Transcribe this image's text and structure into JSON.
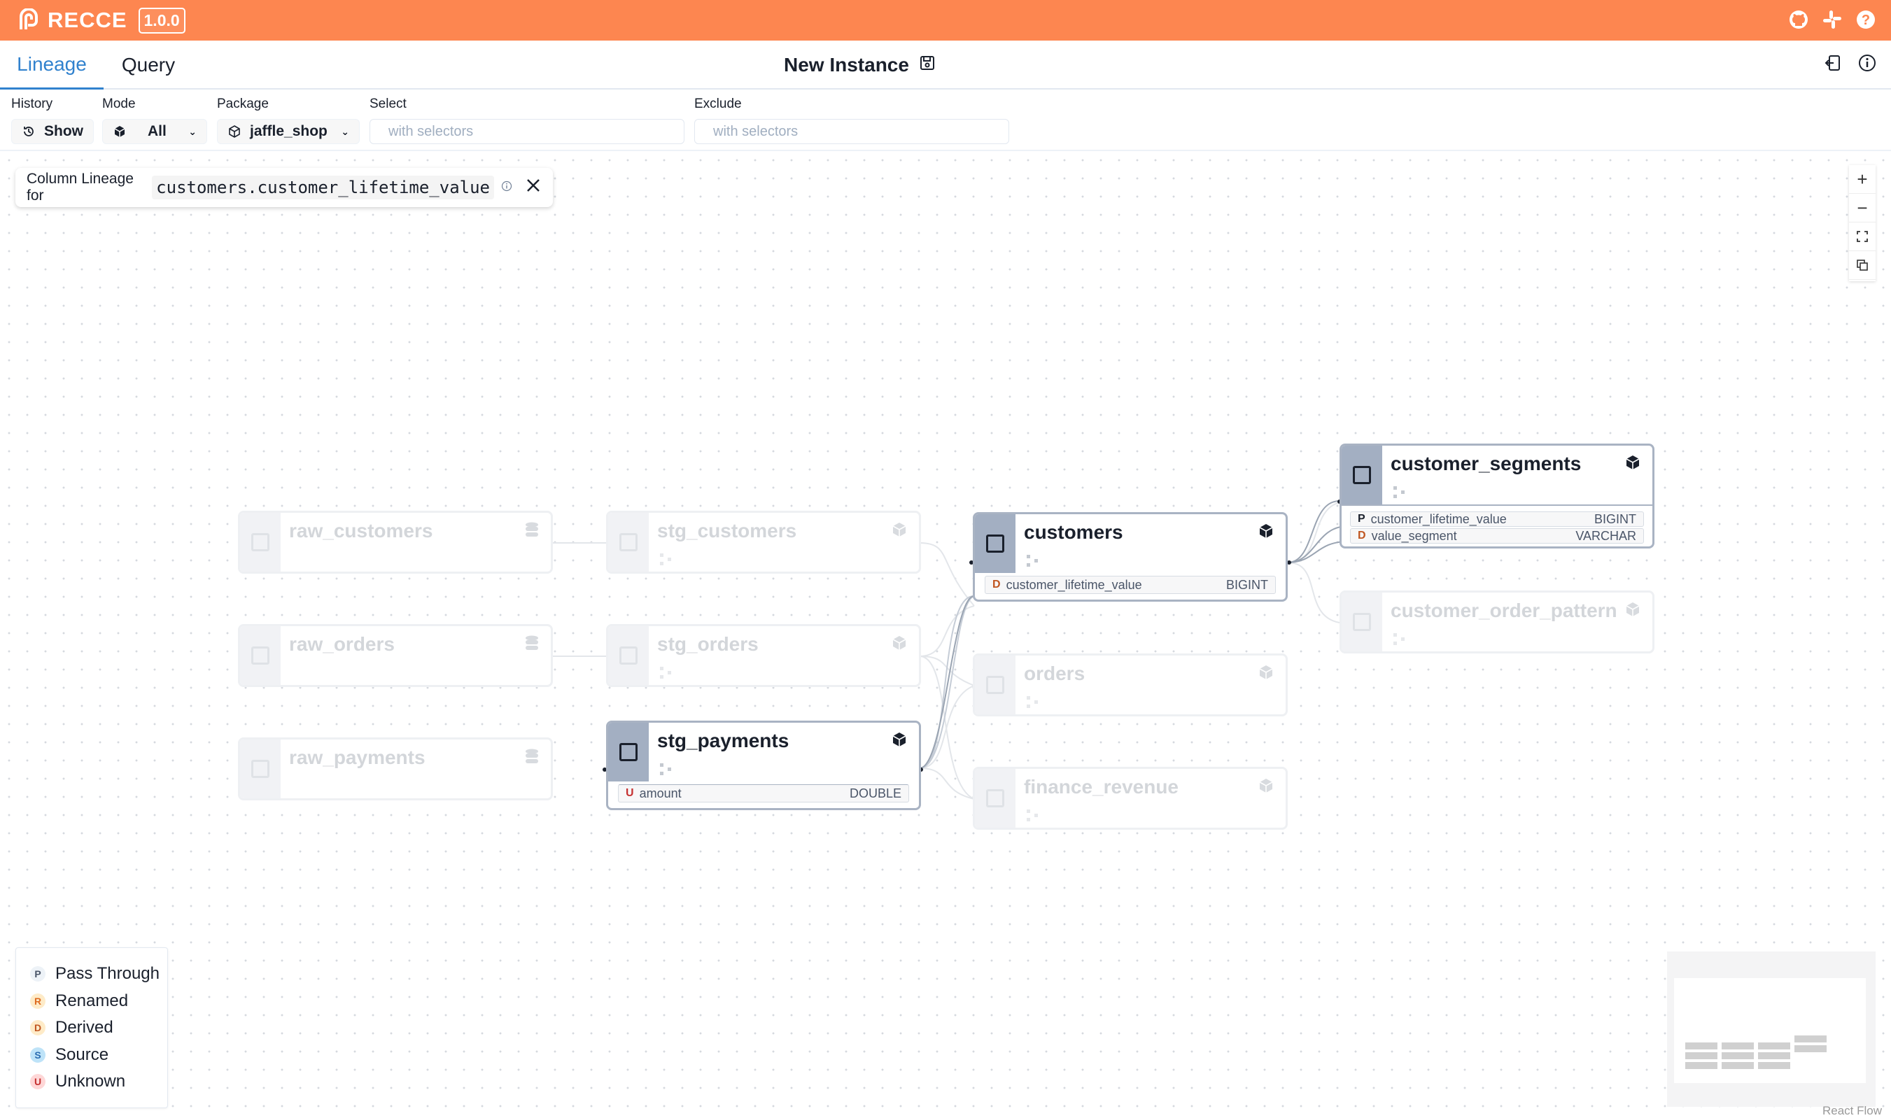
{
  "app": {
    "brand": "RECCE",
    "version": "1.0.0",
    "brand_color": "#fd8650",
    "top_icons": [
      "github-icon",
      "slack-icon",
      "help-icon"
    ]
  },
  "nav": {
    "tabs": [
      {
        "label": "Lineage",
        "active": true
      },
      {
        "label": "Query",
        "active": false
      }
    ],
    "instance_title": "New Instance",
    "right_icons": [
      "export-icon",
      "info-icon"
    ]
  },
  "filters": {
    "history": {
      "label": "History",
      "value": "Show"
    },
    "mode": {
      "label": "Mode",
      "value": "All"
    },
    "package": {
      "label": "Package",
      "value": "jaffle_shop"
    },
    "select": {
      "label": "Select",
      "placeholder": "with selectors"
    },
    "exclude": {
      "label": "Exclude",
      "placeholder": "with selectors"
    }
  },
  "column_lineage": {
    "prefix": "Column Lineage for",
    "column": "customers.customer_lifetime_value"
  },
  "nodes": {
    "raw_customers": {
      "name": "raw_customers",
      "kind": "seed",
      "dimmed": true
    },
    "stg_customers": {
      "name": "stg_customers",
      "kind": "model",
      "dimmed": true
    },
    "raw_orders": {
      "name": "raw_orders",
      "kind": "seed",
      "dimmed": true
    },
    "stg_orders": {
      "name": "stg_orders",
      "kind": "model",
      "dimmed": true
    },
    "raw_payments": {
      "name": "raw_payments",
      "kind": "seed",
      "dimmed": true
    },
    "stg_payments": {
      "name": "stg_payments",
      "kind": "model",
      "dimmed": false,
      "columns": [
        {
          "tag": "U",
          "name": "amount",
          "type": "DOUBLE"
        }
      ]
    },
    "customers": {
      "name": "customers",
      "kind": "model",
      "dimmed": false,
      "columns": [
        {
          "tag": "D",
          "name": "customer_lifetime_value",
          "type": "BIGINT"
        }
      ]
    },
    "orders": {
      "name": "orders",
      "kind": "model",
      "dimmed": true
    },
    "finance_revenue": {
      "name": "finance_revenue",
      "kind": "model",
      "dimmed": true
    },
    "customer_segments": {
      "name": "customer_segments",
      "kind": "model",
      "dimmed": false,
      "columns": [
        {
          "tag": "P",
          "name": "customer_lifetime_value",
          "type": "BIGINT"
        },
        {
          "tag": "D",
          "name": "value_segment",
          "type": "VARCHAR"
        }
      ]
    },
    "customer_order_pattern": {
      "name": "customer_order_pattern",
      "kind": "model",
      "dimmed": true
    }
  },
  "legend": [
    {
      "tag": "P",
      "label": "Pass Through",
      "color": "#4a5568",
      "bg": "#edf2f7"
    },
    {
      "tag": "R",
      "label": "Renamed",
      "color": "#dd6b20",
      "bg": "#feebc8"
    },
    {
      "tag": "D",
      "label": "Derived",
      "color": "#c05621",
      "bg": "#feebc8"
    },
    {
      "tag": "S",
      "label": "Source",
      "color": "#2b6cb0",
      "bg": "#bee3f8"
    },
    {
      "tag": "U",
      "label": "Unknown",
      "color": "#c53030",
      "bg": "#fed7d7"
    }
  ],
  "canvas_controls": [
    "zoom-in-icon",
    "zoom-out-icon",
    "fit-view-icon",
    "copy-icon"
  ],
  "attribution": "React Flow"
}
